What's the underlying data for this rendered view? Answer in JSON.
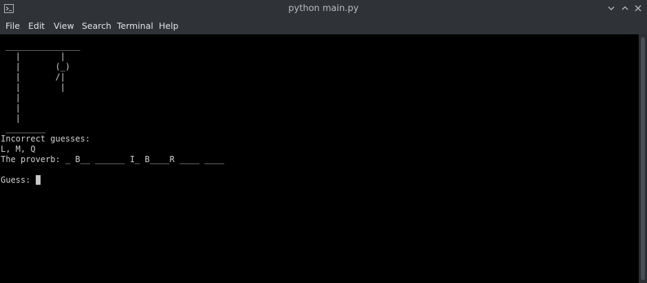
{
  "window": {
    "title": "python main.py",
    "icon": "terminal-icon",
    "controls": [
      "minimize-icon",
      "maximize-icon",
      "close-icon"
    ]
  },
  "menu": {
    "items": [
      "File",
      "Edit",
      "View",
      "Search",
      "Terminal",
      "Help"
    ]
  },
  "terminal": {
    "gallows": [
      " _______________",
      "   |        |",
      "   |       (_)",
      "   |       /|",
      "   |        |",
      "   |",
      "   |",
      "   |",
      " ________"
    ],
    "incorrect_label": "Incorrect guesses:",
    "incorrect_letters": "L, M, Q",
    "proverb_line": "The proverb: _ B__ ______ I_ B____R ____ ____",
    "blank_line": "",
    "prompt": "Guess: "
  },
  "colors": {
    "titlebar_bg": "#2f3237",
    "terminal_bg": "#000000",
    "terminal_fg": "#d3d3d3",
    "cursor": "#c8c8c8"
  }
}
